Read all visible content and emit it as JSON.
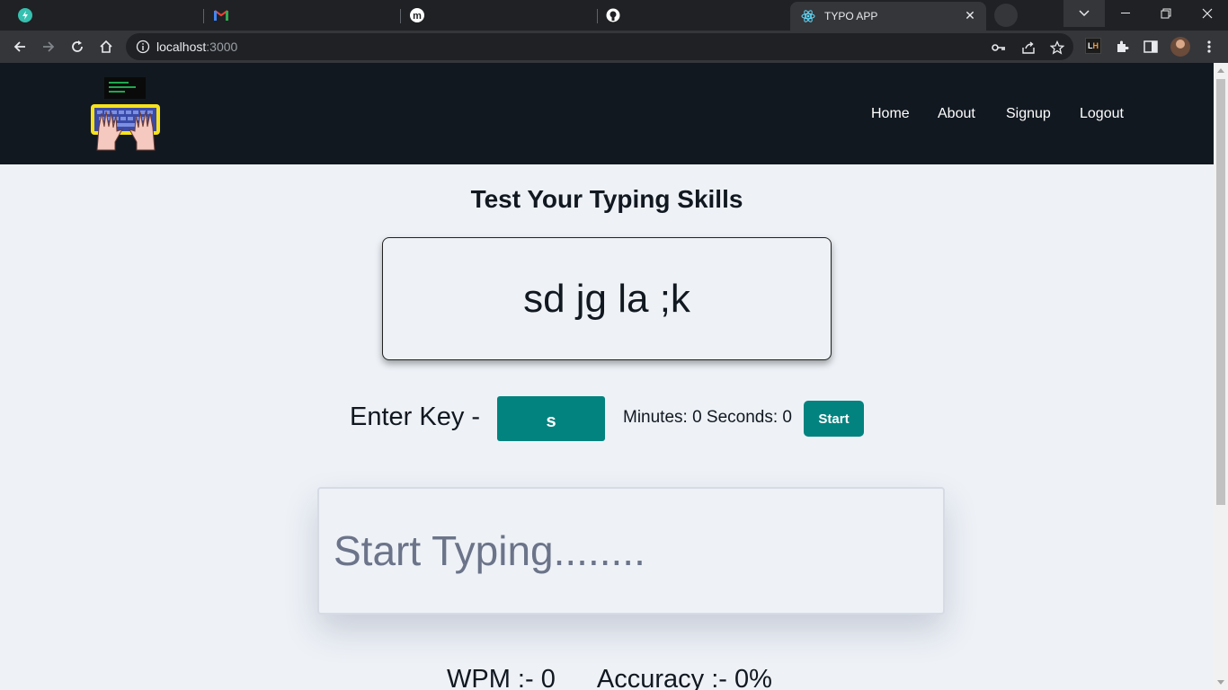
{
  "browser": {
    "tabs": [
      {
        "icon": "bolt-icon",
        "title": ""
      },
      {
        "icon": "gmail-icon",
        "title": ""
      },
      {
        "icon": "m-logo-icon",
        "title": ""
      },
      {
        "icon": "github-icon",
        "title": ""
      },
      {
        "icon": "react-icon",
        "title": "TYPO APP",
        "active": true
      }
    ],
    "url": {
      "host": "localhost",
      "port": ":3000"
    }
  },
  "nav": {
    "logo_icon": "keyboard-hands-icon",
    "links": {
      "home": "Home",
      "about": "About",
      "signup": "Signup",
      "logout": "Logout"
    }
  },
  "main": {
    "heading": "Test Your Typing Skills",
    "target_text": "sd jg la ;k",
    "enter_key_label": "Enter Key -",
    "current_key": "s",
    "timer_text": "Minutes: 0 Seconds: 0",
    "start_label": "Start",
    "typing_placeholder": "Start Typing........",
    "wpm_text": "WPM :- 0",
    "accuracy_text": "Accuracy :- 0%"
  },
  "colors": {
    "accent": "#03837f",
    "navbar": "#111820",
    "background": "#eef2f7"
  }
}
